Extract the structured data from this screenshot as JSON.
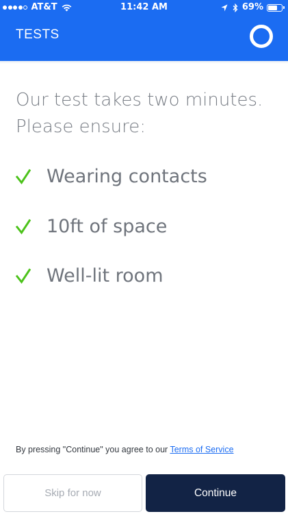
{
  "status_bar": {
    "signal_bars_filled": 4,
    "signal_bars_total": 5,
    "carrier": "AT&T",
    "time": "11:42 AM",
    "battery_percent": "69%",
    "battery_level": 0.69,
    "icons": [
      "wifi-icon",
      "location-arrow-icon",
      "bluetooth-icon",
      "battery-icon"
    ]
  },
  "header": {
    "title": "TESTS",
    "action_icon": "ring-icon",
    "background": "#1b6cf2"
  },
  "intro": {
    "line1": "Our test takes two minutes.",
    "line2": "Please ensure:"
  },
  "checklist": [
    {
      "label": "Wearing contacts",
      "icon": "check-icon"
    },
    {
      "label": "10ft of space",
      "icon": "check-icon"
    },
    {
      "label": "Well-lit room",
      "icon": "check-icon"
    }
  ],
  "check_color": "#4cc21a",
  "terms": {
    "prefix": "By pressing \"Continue\" you agree to our",
    "link": "Terms of Service"
  },
  "buttons": {
    "skip": "Skip for now",
    "continue": "Continue"
  },
  "colors": {
    "accent": "#1b6cf2",
    "continue_bg": "#122345"
  }
}
